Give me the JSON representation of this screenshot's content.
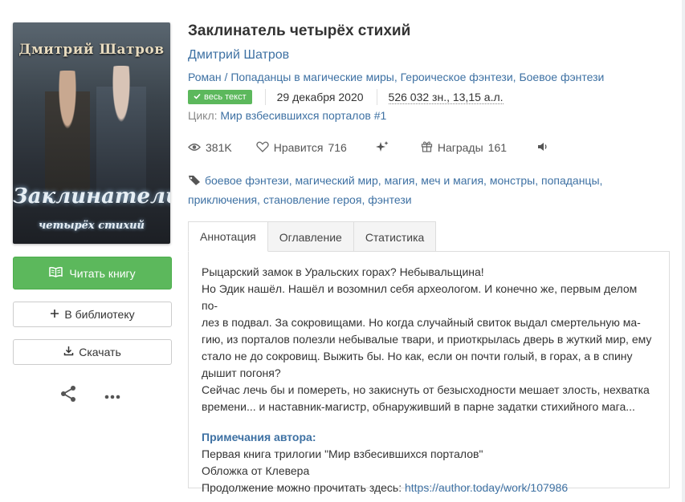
{
  "book": {
    "title": "Заклинатель четырёх стихий",
    "author": "Дмитрий Шатров",
    "genres": [
      "Роман",
      "Попаданцы в магические миры",
      "Героическое фэнтези",
      "Боевое фэнтези"
    ],
    "genre_sep_first": " / ",
    "genre_sep": ", ",
    "badge": "весь текст",
    "date": "29 декабря 2020",
    "chars": "526 032 зн., 13,15 а.л.",
    "cycle_label": "Цикл:",
    "cycle_name": "Мир взбесившихся порталов #1"
  },
  "cover": {
    "author_text": "Дмитрий Шатров",
    "title_text": "Заклинатель",
    "subtitle_text": "четырёх стихий"
  },
  "stats": {
    "views": "381K",
    "likes_label": "Нравится",
    "likes_count": "716",
    "awards_label": "Награды",
    "awards_count": "161"
  },
  "tags": [
    "боевое фэнтези",
    "магический мир",
    "магия",
    "меч и магия",
    "монстры",
    "попаданцы",
    "приключения",
    "становление героя",
    "фэнтези"
  ],
  "buttons": {
    "read": "Читать книгу",
    "library": "В библиотеку",
    "download": "Скачать"
  },
  "tabs": [
    {
      "label": "Аннотация",
      "active": true
    },
    {
      "label": "Оглавление",
      "active": false
    },
    {
      "label": "Статистика",
      "active": false
    }
  ],
  "annotation": {
    "lines": [
      "Рыцарский замок в Уральских горах? Небывальщина!",
      "Но Эдик нашёл. Нашёл и возомнил себя археологом. И конечно же, первым делом по-",
      "лез в подвал. За сокровищами. Но когда случайный свиток выдал смертельную ма-",
      "гию, из порталов полезли небывалые твари, и приоткрылась дверь в жуткий мир, ему",
      "стало не до сокровищ. Выжить бы. Но как, если он почти голый, в горах, а в спину",
      "дышит погоня?",
      "Сейчас лечь бы и помереть, но закиснуть от безысходности мешает злость, нехватка",
      "времени... и наставник-магистр, обнаруживший в парне задатки стихийного мага..."
    ],
    "notes_heading": "Примечания автора:",
    "notes_lines": [
      "Первая книга трилогии \"Мир взбесившихся порталов\"",
      "Обложка от Клевера"
    ],
    "continuation_text": "Продолжение можно прочитать здесь: ",
    "continuation_link": "https://author.today/work/107986"
  },
  "colors": {
    "accent": "#3e71a3",
    "read_button": "#5cb85c",
    "badge": "#5cb85c"
  },
  "icons": [
    "book-open-icon",
    "plus-icon",
    "download-icon",
    "share-icon",
    "more-icon",
    "check-icon",
    "eye-icon",
    "heart-icon",
    "sparkle-icon",
    "gift-icon",
    "volume-icon",
    "tag-icon"
  ]
}
